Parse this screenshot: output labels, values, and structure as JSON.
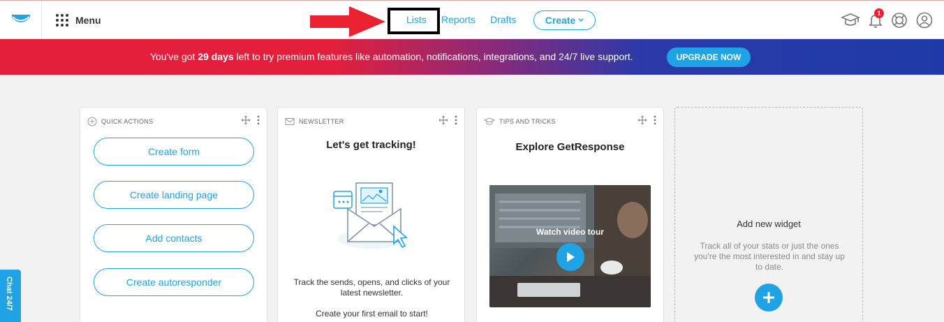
{
  "nav": {
    "menu_label": "Menu",
    "links": [
      "Lists",
      "Reports",
      "Drafts"
    ],
    "create_label": "Create",
    "notification_count": "1",
    "icons": [
      "graduation-cap-icon",
      "bell-icon",
      "lifebuoy-icon",
      "user-icon"
    ]
  },
  "banner": {
    "prefix": "You've got ",
    "days": "29 days",
    "suffix": " left to try premium features like automation, notifications, integrations, and 24/7 live support.",
    "upgrade_label": "UPGRADE NOW"
  },
  "quick_actions": {
    "header": "QUICK ACTIONS",
    "buttons": [
      "Create form",
      "Create landing page",
      "Add contacts",
      "Create autoresponder"
    ]
  },
  "newsletter": {
    "header": "NEWSLETTER",
    "title": "Let's get tracking!",
    "body": "Track the sends, opens, and clicks of your latest newsletter.",
    "cta_text": "Create your first email to start!"
  },
  "tips": {
    "header": "TIPS AND TRICKS",
    "title": "Explore GetResponse",
    "video_label": "Watch video tour"
  },
  "add_widget": {
    "title": "Add new widget",
    "text": "Track all of your stats or just the ones you're the most interested in and stay up to date."
  },
  "chat": {
    "label": "Chat 24/7"
  },
  "colors": {
    "accent": "#1fa3e4",
    "banner_start": "#e41f3b",
    "banner_end": "#1f3aa8",
    "annotation": "#e8232f"
  }
}
